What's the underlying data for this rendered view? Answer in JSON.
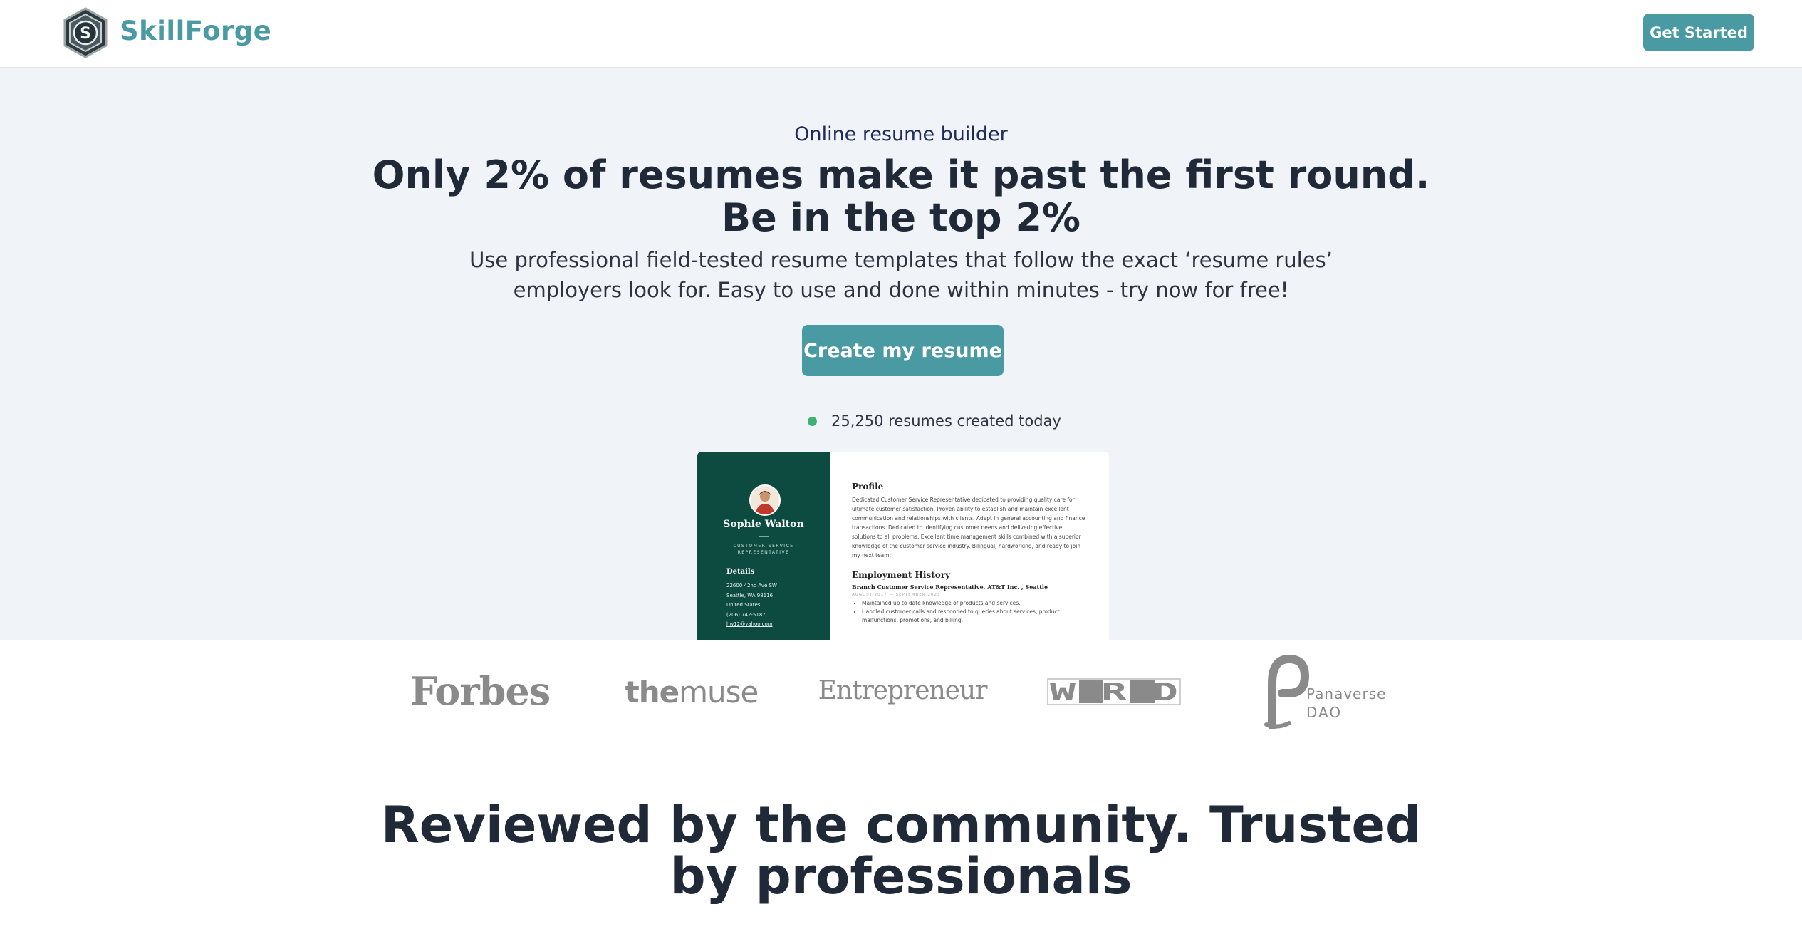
{
  "header": {
    "brand": "SkillForge",
    "logo_letter": "S",
    "cta_label": "Get Started"
  },
  "hero": {
    "eyebrow": "Online resume builder",
    "headline_line1": "Only 2% of resumes make it past the first round.",
    "headline_line2": "Be in the top 2%",
    "subhead_line1": "Use professional field-tested resume templates that follow the exact ‘resume rules’",
    "subhead_line2": "employers look for. Easy to use and done within minutes - try now for free!",
    "cta_label": "Create my resume",
    "counter_text": "25,250 resumes created today",
    "status_color": "#3bb273"
  },
  "resume_preview": {
    "name": "Sophie Walton",
    "role_line1": "CUSTOMER SERVICE",
    "role_line2": "REPRESENTATIVE",
    "details_heading": "Details",
    "details": [
      "22600 42nd Ave SW",
      "Seattle, WA 98116",
      "United States",
      "(206) 742-5187",
      "hw12@yahoo.com"
    ],
    "profile_heading": "Profile",
    "profile_text": "Dedicated Customer Service Representative dedicated to providing quality care for ultimate customer satisfaction. Proven ability to establish and maintain excellent communication and relationships with clients. Adept in general accounting and finance transactions. Dedicated to identifying customer needs and delivering effective solutions to all problems. Excellent time management skills combined with a superior knowledge of the customer service industry. Bilingual, hardworking, and ready to join my next team.",
    "employment_heading": "Employment History",
    "job_title": "Branch Customer Service Representative, AT&T Inc. , Seattle",
    "job_dates": "AUGUST 2017 — SEPTEMBER 2023",
    "bullets": [
      "Maintained up to date knowledge of products and services.",
      "Handled customer calls and responded to queries about services, product malfunctions, promotions, and billing."
    ]
  },
  "press_logos": {
    "forbes": "Forbes",
    "muse_a": "the",
    "muse_b": "muse",
    "entrepreneur": "Entrepreneur",
    "wired": "WIRED",
    "panaverse_line1": "Panaverse",
    "panaverse_line2": "DAO"
  },
  "reviews": {
    "heading_line1": "Reviewed by the community. Trusted",
    "heading_line2": "by professionals"
  },
  "colors": {
    "accent": "#4a9aa3",
    "hero_bg": "#f0f3f8",
    "resume_sidebar": "#0d4b40",
    "heading": "#1f2937"
  }
}
